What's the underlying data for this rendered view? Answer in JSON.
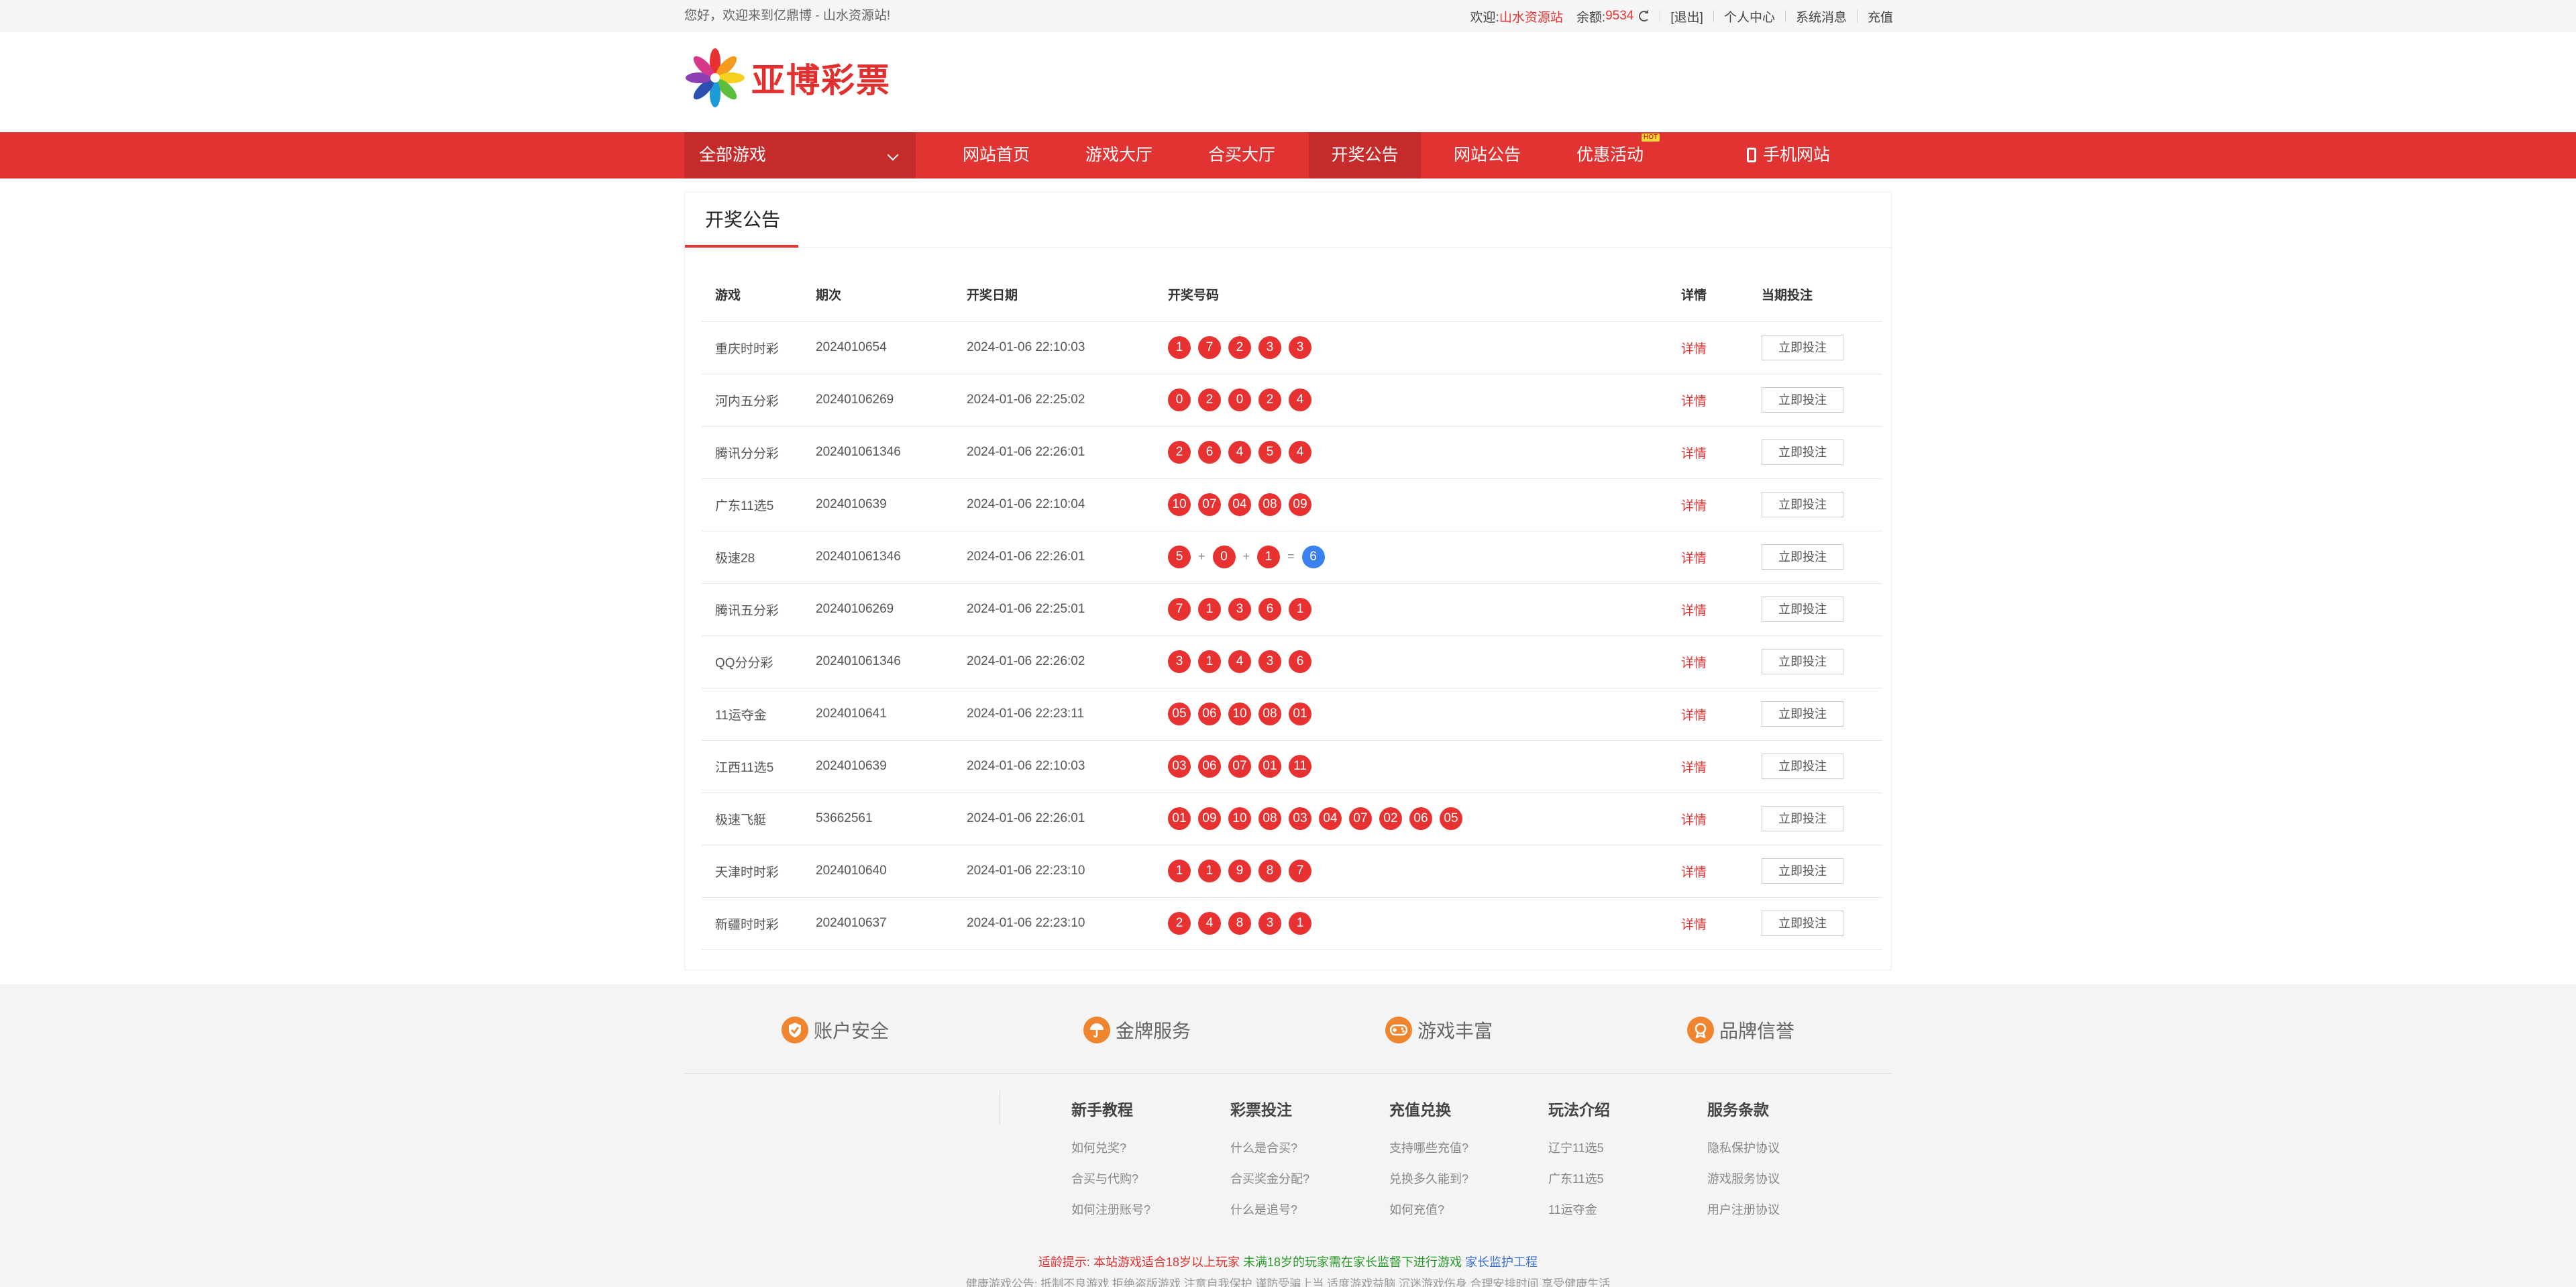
{
  "topbar": {
    "welcome": "您好，欢迎来到亿鼎博 - 山水资源站!",
    "greeting": "欢迎:",
    "username": "山水资源站",
    "balance_label": "余额:",
    "balance": "9534",
    "logout": "[退出]",
    "user_center": "个人中心",
    "messages": "系统消息",
    "recharge": "充值"
  },
  "header": {
    "logo_text": "亚博彩票"
  },
  "nav": {
    "all_games": "全部游戏",
    "items": [
      {
        "label": "网站首页"
      },
      {
        "label": "游戏大厅"
      },
      {
        "label": "合买大厅"
      },
      {
        "label": "开奖公告"
      },
      {
        "label": "网站公告"
      },
      {
        "label": "优惠活动"
      }
    ],
    "hot_badge": "HOT",
    "mobile": "手机网站"
  },
  "main": {
    "panel_title": "开奖公告",
    "columns": [
      "游戏",
      "期次",
      "开奖日期",
      "开奖号码",
      "详情",
      "当期投注"
    ],
    "detail_label": "详情",
    "bet_label": "立即投注",
    "rows": [
      {
        "game": "重庆时时彩",
        "period": "2024010654",
        "date": "2024-01-06 22:10:03",
        "balls": [
          "1",
          "7",
          "2",
          "3",
          "3"
        ]
      },
      {
        "game": "河内五分彩",
        "period": "20240106269",
        "date": "2024-01-06 22:25:02",
        "balls": [
          "0",
          "2",
          "0",
          "2",
          "4"
        ]
      },
      {
        "game": "腾讯分分彩",
        "period": "202401061346",
        "date": "2024-01-06 22:26:01",
        "balls": [
          "2",
          "6",
          "4",
          "5",
          "4"
        ]
      },
      {
        "game": "广东11选5",
        "period": "2024010639",
        "date": "2024-01-06 22:10:04",
        "balls": [
          "10",
          "07",
          "04",
          "08",
          "09"
        ]
      },
      {
        "game": "极速28",
        "period": "202401061346",
        "date": "2024-01-06 22:26:01",
        "sum": {
          "a": "5",
          "b": "0",
          "c": "1",
          "result": "6"
        }
      },
      {
        "game": "腾讯五分彩",
        "period": "20240106269",
        "date": "2024-01-06 22:25:01",
        "balls": [
          "7",
          "1",
          "3",
          "6",
          "1"
        ]
      },
      {
        "game": "QQ分分彩",
        "period": "202401061346",
        "date": "2024-01-06 22:26:02",
        "balls": [
          "3",
          "1",
          "4",
          "3",
          "6"
        ]
      },
      {
        "game": "11运夺金",
        "period": "2024010641",
        "date": "2024-01-06 22:23:11",
        "balls": [
          "05",
          "06",
          "10",
          "08",
          "01"
        ]
      },
      {
        "game": "江西11选5",
        "period": "2024010639",
        "date": "2024-01-06 22:10:03",
        "balls": [
          "03",
          "06",
          "07",
          "01",
          "11"
        ]
      },
      {
        "game": "极速飞艇",
        "period": "53662561",
        "date": "2024-01-06 22:26:01",
        "balls": [
          "01",
          "09",
          "10",
          "08",
          "03",
          "04",
          "07",
          "02",
          "06",
          "05"
        ]
      },
      {
        "game": "天津时时彩",
        "period": "2024010640",
        "date": "2024-01-06 22:23:10",
        "balls": [
          "1",
          "1",
          "9",
          "8",
          "7"
        ]
      },
      {
        "game": "新疆时时彩",
        "period": "2024010637",
        "date": "2024-01-06 22:23:10",
        "balls": [
          "2",
          "4",
          "8",
          "3",
          "1"
        ]
      }
    ]
  },
  "footer": {
    "features": [
      {
        "label": "账户安全",
        "icon": "shield-icon"
      },
      {
        "label": "金牌服务",
        "icon": "umbrella-icon"
      },
      {
        "label": "游戏丰富",
        "icon": "gamepad-icon"
      },
      {
        "label": "品牌信誉",
        "icon": "medal-icon"
      }
    ],
    "columns": [
      {
        "title": "新手教程",
        "links": [
          "如何兑奖?",
          "合买与代购?",
          "如何注册账号?"
        ]
      },
      {
        "title": "彩票投注",
        "links": [
          "什么是合买?",
          "合买奖金分配?",
          "什么是追号?"
        ]
      },
      {
        "title": "充值兑换",
        "links": [
          "支持哪些充值?",
          "兑换多久能到?",
          "如何充值?"
        ]
      },
      {
        "title": "玩法介绍",
        "links": [
          "辽宁11选5",
          "广东11选5",
          "11运夺金"
        ]
      },
      {
        "title": "服务条款",
        "links": [
          "隐私保护协议",
          "游戏服务协议",
          "用户注册协议"
        ]
      }
    ],
    "tip_label": "适龄提示:",
    "tip_red": "本站游戏适合18岁以上玩家",
    "tip_green": "未满18岁的玩家需在家长监督下进行游戏",
    "tip_blue": "家长监护工程",
    "notice": "健康游戏公告: 抵制不良游戏 拒绝盗版游戏 注意自我保护 谨防受骗上当 适度游戏益脑 沉迷游戏伤身 合理安排时间 享受健康生活"
  },
  "colors": {
    "brand_red": "#e23333",
    "ball_red": "#e83232",
    "ball_blue": "#3b82f0",
    "feature_orange": "#f0852f"
  }
}
